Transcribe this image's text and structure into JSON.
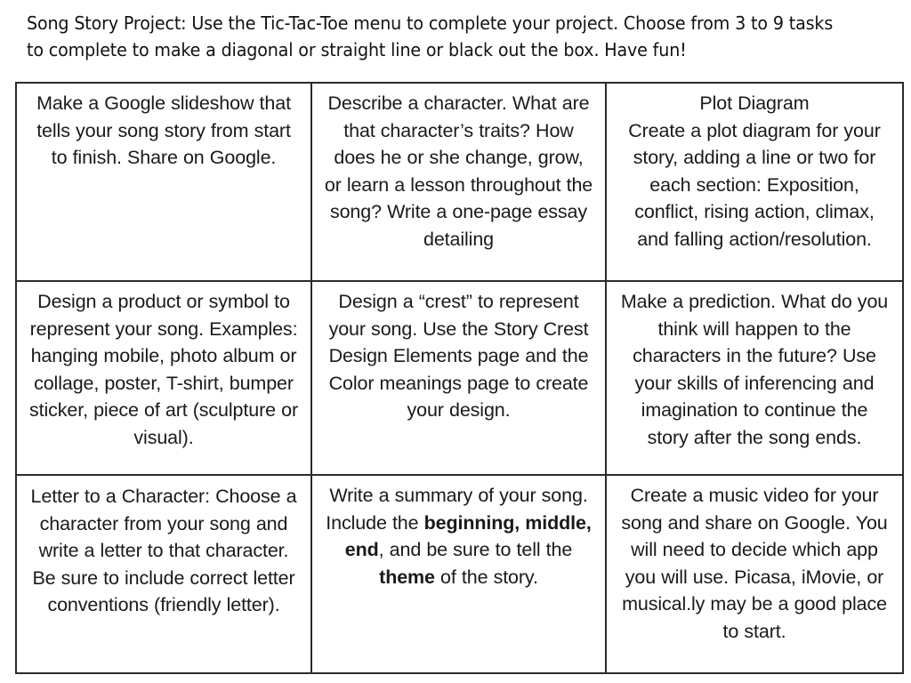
{
  "header": {
    "line1": "Song Story Project: Use the Tic-Tac-Toe menu to complete your project. Choose from 3 to",
    "line2": "9 tasks to complete to make a diagonal or straight line or black out the box. Have fun!",
    "full_text": "Song Story Project: Use the Tic-Tac-Toe menu to complete your project. Choose from 3 to 9 tasks to complete to make a diagonal or straight line or black out the box. Have fun!"
  },
  "colors": {
    "page_background": "#ffffff",
    "text": "#1a1a1a",
    "header_text": "#111111",
    "table_border": "#2b2b2b"
  },
  "table": {
    "rows": 3,
    "columns": 3,
    "cells": [
      {
        "id": "cell-r1c1",
        "row": 1,
        "column": 1,
        "text": "Make a Google slideshow that tells your song story from start to finish. Share on Google."
      },
      {
        "id": "cell-r1c2",
        "row": 1,
        "column": 2,
        "text": "Describe a character. What are that character’s traits? How does he or she change, grow, or learn a lesson throughout the song? Write a one-page essay detailing"
      },
      {
        "id": "cell-r1c3",
        "row": 1,
        "column": 3,
        "text": "Plot Diagram Create a plot diagram for your story, adding a line or two for each section: Exposition, conflict, rising action, climax, and falling action/resolution.",
        "line1": "Plot Diagram",
        "line2": "Create a plot diagram for your story, adding a line or two for each section: Exposition, conflict, rising action, climax, and falling action/resolution."
      },
      {
        "id": "cell-r2c1",
        "row": 2,
        "column": 1,
        "text": "Design a product or symbol to represent your song. Examples: hanging mobile, photo album or collage, poster, T-shirt, bumper sticker, piece of art (sculpture or visual)."
      },
      {
        "id": "cell-r2c2",
        "row": 2,
        "column": 2,
        "text": "Design a “crest” to represent your song. Use the Story Crest Design Elements page and the Color meanings page to create your design."
      },
      {
        "id": "cell-r2c3",
        "row": 2,
        "column": 3,
        "text": "Make a prediction. What do you think will happen to the characters in the future? Use your skills of inferencing and imagination to continue the story after the song ends."
      },
      {
        "id": "cell-r3c1",
        "row": 3,
        "column": 1,
        "text": "Letter to a Character: Choose a character from your song and write a letter to that character. Be sure to include correct letter conventions (friendly letter)."
      },
      {
        "id": "cell-r3c2",
        "row": 3,
        "column": 2,
        "text": "Write a summary of your song. Include the beginning, middle, end, and be sure to tell the theme of the story.",
        "segment_1": "Write a summary of your song. Include the ",
        "segment_2_bold": "beginning, middle, end",
        "segment_3": ", and be sure to tell the ",
        "segment_4_bold": "theme",
        "segment_5": " of the story."
      },
      {
        "id": "cell-r3c3",
        "row": 3,
        "column": 3,
        "text": "Create a music video for your song and share on Google. You will need to decide which app you will use. Picasa, iMovie, or musical.ly may be a good place to start."
      }
    ]
  }
}
